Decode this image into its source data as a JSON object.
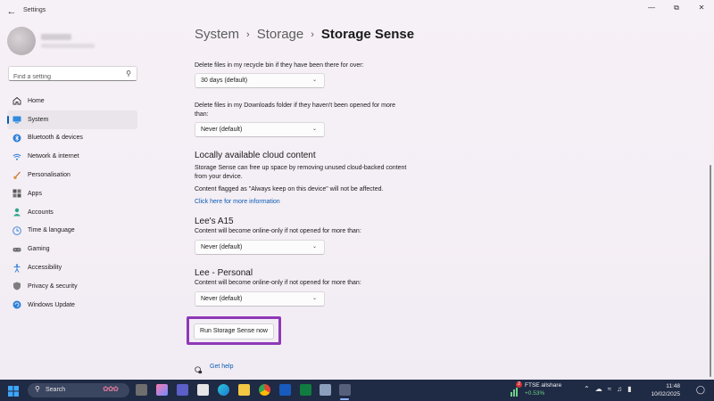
{
  "window": {
    "app_title": "Settings",
    "controls": [
      "minimize-icon",
      "maximize-icon",
      "close-icon"
    ]
  },
  "sidebar": {
    "search_placeholder": "Find a setting",
    "items": [
      {
        "label": "Home",
        "icon": "home-icon"
      },
      {
        "label": "System",
        "icon": "system-icon",
        "active": true
      },
      {
        "label": "Bluetooth & devices",
        "icon": "bluetooth-icon"
      },
      {
        "label": "Network & internet",
        "icon": "wifi-icon"
      },
      {
        "label": "Personalisation",
        "icon": "brush-icon"
      },
      {
        "label": "Apps",
        "icon": "apps-icon"
      },
      {
        "label": "Accounts",
        "icon": "account-icon"
      },
      {
        "label": "Time & language",
        "icon": "globe-clock-icon"
      },
      {
        "label": "Gaming",
        "icon": "gamepad-icon"
      },
      {
        "label": "Accessibility",
        "icon": "accessibility-icon"
      },
      {
        "label": "Privacy & security",
        "icon": "shield-icon"
      },
      {
        "label": "Windows Update",
        "icon": "update-icon"
      }
    ]
  },
  "breadcrumb": {
    "items": [
      "System",
      "Storage"
    ],
    "current": "Storage Sense"
  },
  "content": {
    "recycle_label": "Delete files in my recycle bin if they have been there for over:",
    "recycle_value": "30 days (default)",
    "downloads_label": "Delete files in my Downloads folder if they haven't been opened for more than:",
    "downloads_value": "Never (default)",
    "cloud_heading": "Locally available cloud content",
    "cloud_desc": "Storage Sense can free up space by removing unused cloud-backed content from your device.",
    "cloud_flagged": "Content flagged as \"Always keep on this device\" will not be affected.",
    "cloud_link": "Click here for more information",
    "accounts": [
      {
        "name": "Lee's A15",
        "desc": "Content will become online-only if not opened for more than:",
        "value": "Never (default)"
      },
      {
        "name": "Lee - Personal",
        "desc": "Content will become online-only if not opened for more than:",
        "value": "Never (default)"
      }
    ],
    "run_button": "Run Storage Sense now",
    "help_link": "Get help",
    "highlight_color": "#8f38b8"
  },
  "taskbar": {
    "search_text": "Search",
    "stock_name": "FTSE allshare",
    "stock_change": "+0.53%",
    "stock_badge": "2",
    "time": "11:48",
    "date": "10/02/2025",
    "tray_icons": [
      "chevron-up-icon",
      "cloud-icon",
      "wifi-icon",
      "speaker-icon",
      "battery-icon"
    ]
  }
}
